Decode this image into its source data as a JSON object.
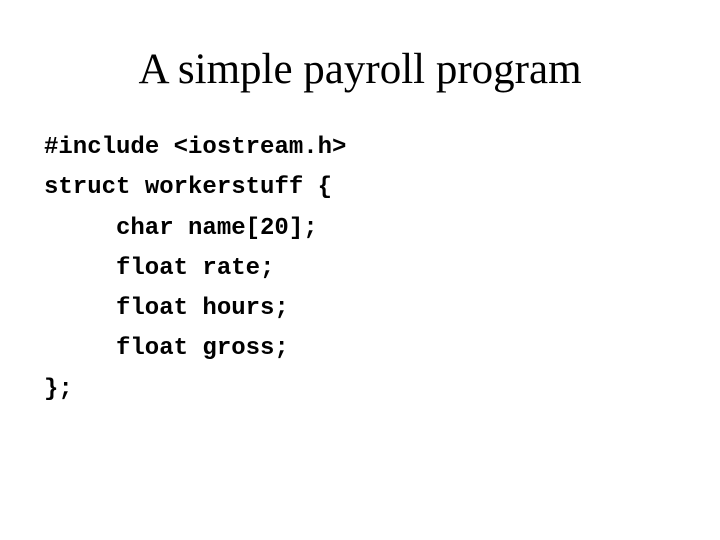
{
  "slide": {
    "title": "A simple payroll program",
    "code_lines": [
      {
        "text": "#include <iostream.h>",
        "indent": 0
      },
      {
        "text": "struct workerstuff {",
        "indent": 0
      },
      {
        "text": "char name[20];",
        "indent": 1
      },
      {
        "text": "float rate;",
        "indent": 1
      },
      {
        "text": "float hours;",
        "indent": 1
      },
      {
        "text": "float gross;",
        "indent": 1
      },
      {
        "text": "};",
        "indent": 0
      }
    ]
  }
}
